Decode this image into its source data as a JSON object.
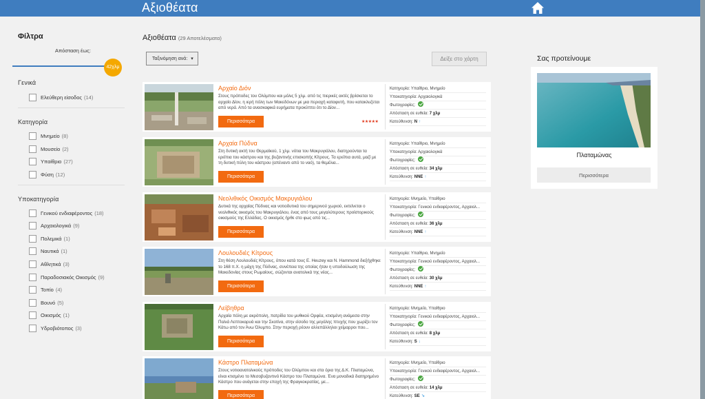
{
  "header": {
    "title": "Αξιοθέατα",
    "home_icon": "home-icon"
  },
  "sidebar": {
    "title": "Φίλτρα",
    "distance_label": "Απόσταση έως:",
    "distance_value": "42χλμ",
    "groups": [
      {
        "title": "Γενικά",
        "items": [
          {
            "label": "Ελεύθερη είσοδος",
            "count": "(14)"
          }
        ]
      },
      {
        "title": "Κατηγορία",
        "items": [
          {
            "label": "Μνημείο",
            "count": "(8)"
          },
          {
            "label": "Μουσείο",
            "count": "(2)"
          },
          {
            "label": "Υπαίθριο",
            "count": "(27)"
          },
          {
            "label": "Φύση",
            "count": "(12)"
          }
        ]
      },
      {
        "title": "Υποκατηγορία",
        "items": [
          {
            "label": "Γενικού ενδιαφέροντος",
            "count": "(18)"
          },
          {
            "label": "Αρχαιολογικά",
            "count": "(9)"
          },
          {
            "label": "Πολεμικά",
            "count": "(1)"
          },
          {
            "label": "Ναυτικά",
            "count": "(1)"
          },
          {
            "label": "Αθλητικά",
            "count": "(3)"
          },
          {
            "label": "Παραδοσιακός Οικισμός",
            "count": "(9)"
          },
          {
            "label": "Τοπίο",
            "count": "(4)"
          },
          {
            "label": "Βουνό",
            "count": "(5)"
          },
          {
            "label": "Οικισμός",
            "count": "(1)"
          },
          {
            "label": "Υδροβιότοπος",
            "count": "(3)"
          }
        ]
      }
    ]
  },
  "results": {
    "title": "Αξιοθέατα",
    "count": "(29 Αποτελέσματα)",
    "sort_label": "Ταξινόμηση ανά:",
    "map_button": "Δείξε στο χάρτη",
    "more_label": "Περισσότερα",
    "meta_labels": {
      "category": "Κατηγορία:",
      "subcategory": "Υποκατηγορία:",
      "photos": "Φωτογραφίες:",
      "distance": "Απόσταση σε ευθεία:",
      "direction": "Κατεύθυνση:"
    },
    "items": [
      {
        "name": "Αρχαίο Διόν",
        "desc": "Στους πρόποδες του Ολύμπου και μόλις 5 χλμ. από τις πιερικές ακτές βρίσκεται το αρχαίο Δίον, η ιερή πόλη των Μακεδόνων με μια περιοχή καταφυτή, που κατακλυζεται από νερά. Από τα ανασκαφικά ευρήματα προκύπτει ότι το Δίον...",
        "category": "Υπαίθριο, Μνημείο",
        "subcategory": "Αρχαιολογικά",
        "distance": "7 χλμ",
        "direction": "N",
        "arrow": "↑",
        "stars": "★★★★★"
      },
      {
        "name": "Αρχαία Πύδνα",
        "desc": "Στη δυτική ακτή του Θερμαϊκού, 1 χλμ. νότια του Μακρυγιάλου, διατηρούνται τα ερείπια του κάστρου και της βυζαντινής επισκοπής Κίτρους. Τα ερείπια αυτά, μαζί με τη δυτική πύλη του κάστρου (απέναντι από το ναό), τα θεμέλια...",
        "category": "Υπαίθριο, Μνημείο",
        "subcategory": "Αρχαιολογικά",
        "distance": "34 χλμ",
        "direction": "NNE",
        "arrow": "↑"
      },
      {
        "name": "Νεολιθικός Οικισμός Μακρυγιάλου",
        "desc": "Δυτικά της αρχαίας Πύδνας και νοτιοδυτικά του σημερινού χωριού, εκτείνεται ο νεολιθικός οικισμός του Μακρυγιάλου, ένας από τους μεγαλύτερους προϊστορικούς οικισμούς της Ελλάδας. Ο οικισμός ήρθε στο φως από τις...",
        "category": "Μνημείο, Υπαίθριο",
        "subcategory": "Γενικού ενδιαφέροντος, Αρχαιολ...",
        "distance": "36 χλμ",
        "direction": "NNE",
        "arrow": "↑"
      },
      {
        "name": "Λουλουδιές Κίτρους",
        "desc": "Στη θέση Λουλουδιές Κίτρους, όπου κατά τους Ε. Heuzey και N. Hammond διεξήχθηκε το 168 π.Χ. η μάχη της Πύδνας, συνέπεια της οποίας ήταν η υποδούλωση της Μακεδονίας στους Ρωμαίους, σώζονται ανατολικά της νέας...",
        "category": "Υπαίθριο, Μνημείο",
        "subcategory": "Γενικού ενδιαφέροντος, Αρχαιολ...",
        "distance": "30 χλμ",
        "direction": "NNE",
        "arrow": "↑"
      },
      {
        "name": "Λείβηθρα",
        "desc": "Αρχαία πόλη με ακρόπολη, πατρίδα του μυθικού Ορφέα, κτισμένη ανάμεσα στην Παλιά Λεπτοκαρυά και την Σκοτίνα, στην είσοδο της μεγάλης πτυχής που χωρίζει τον Κάτω από τον Άνω Όλυμπο. Στην περιοχή ρέουν αλλεπάλληλοι χείμαρροι που...",
        "category": "Μνημείο, Υπαίθριο",
        "subcategory": "Γενικού ενδιαφέροντος, Αρχαιολ...",
        "distance": "8 χλμ",
        "direction": "S",
        "arrow": "↓"
      },
      {
        "name": "Κάστρο Πλαταμώνα",
        "desc": "Στους νοτιοανατολικούς πρόποδες του Ολύμπου και στα όρια της Δ.Κ. Πλαταμώνα, είναι κτισμένο το Μεσοβυζαντινό Κάστρο του Πλαταμώνα. Ένα μοναδικά διατηρημένο Κάστρο που ανάγεται στην εποχή της Φραγκοκρατίας, με...",
        "category": "Μνημείο, Υπαίθριο",
        "subcategory": "Γενικού ενδιαφέροντος, Αρχαιολ...",
        "distance": "14 χλμ",
        "direction": "SE",
        "arrow": "↘"
      }
    ]
  },
  "suggest": {
    "title": "Σας προτείνουμε",
    "place": "Πλαταμώνας",
    "button": "Περισσότερα"
  }
}
